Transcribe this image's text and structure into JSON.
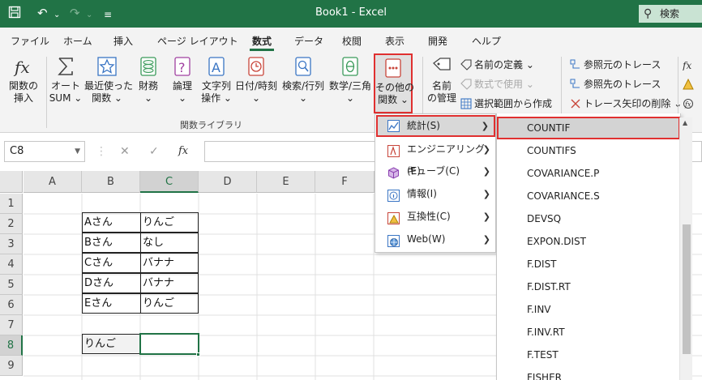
{
  "titlebar": {
    "title": "Book1 - Excel",
    "search_label": "検索"
  },
  "menu_tabs": [
    "ファイル",
    "ホーム",
    "挿入",
    "ページ レイアウト",
    "数式",
    "データ",
    "校閲",
    "表示",
    "開発",
    "ヘルプ"
  ],
  "active_tab": "数式",
  "ribbon": {
    "insert_function": [
      "関数の",
      "挿入"
    ],
    "autosum": [
      "オート",
      "SUM ⌄"
    ],
    "recent": [
      "最近使った",
      "関数 ⌄"
    ],
    "financial": [
      "財務",
      "⌄"
    ],
    "logical": [
      "論理",
      "⌄"
    ],
    "text": [
      "文字列",
      "操作 ⌄"
    ],
    "datetime": [
      "日付/時刻",
      "⌄"
    ],
    "lookup": [
      "検索/行列",
      "⌄"
    ],
    "math": [
      "数学/三角",
      "⌄"
    ],
    "more": [
      "その他の",
      "関数 ⌄"
    ],
    "name_manager": [
      "名前",
      "の管理"
    ],
    "define_name": "名前の定義 ⌄",
    "use_in_formula": "数式で使用 ⌄",
    "create_from_selection": "選択範囲から作成",
    "trace_precedents": "参照元のトレース",
    "trace_dependents": "参照先のトレース",
    "remove_arrows": "トレース矢印の削除 ⌄",
    "group_label": "関数ライブラリ"
  },
  "formula_bar": {
    "name_box": "C8",
    "cancel": "✕",
    "enter": "✓",
    "fx": "fx"
  },
  "columns": [
    "A",
    "B",
    "C",
    "D",
    "E",
    "F"
  ],
  "rows": [
    "1",
    "2",
    "3",
    "4",
    "5",
    "6",
    "7",
    "8",
    "9"
  ],
  "cells": {
    "B2": "Aさん",
    "C2": "りんご",
    "B3": "Bさん",
    "C3": "なし",
    "B4": "Cさん",
    "C4": "バナナ",
    "B5": "Dさん",
    "C5": "バナナ",
    "B6": "Eさん",
    "C6": "りんご",
    "B8": "りんご",
    "C8": ""
  },
  "more_functions_menu": [
    {
      "label": "統計(S)",
      "icon": "statistics-icon"
    },
    {
      "label": "エンジニアリング(E)",
      "icon": "engineering-icon"
    },
    {
      "label": "キューブ(C)",
      "icon": "cube-icon"
    },
    {
      "label": "情報(I)",
      "icon": "info-icon"
    },
    {
      "label": "互換性(C)",
      "icon": "compatibility-icon"
    },
    {
      "label": "Web(W)",
      "icon": "web-icon"
    }
  ],
  "statistics_functions": [
    "COUNTIF",
    "COUNTIFS",
    "COVARIANCE.P",
    "COVARIANCE.S",
    "DEVSQ",
    "EXPON.DIST",
    "F.DIST",
    "F.DIST.RT",
    "F.INV",
    "F.INV.RT",
    "F.TEST",
    "FISHER"
  ],
  "colors": {
    "excel_green": "#217346",
    "highlight_red": "#e03030"
  }
}
